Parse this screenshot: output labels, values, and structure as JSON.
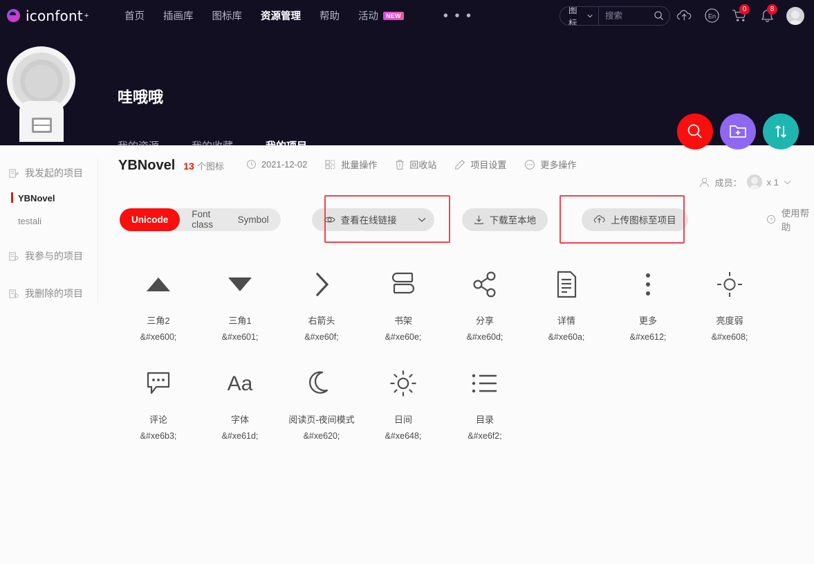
{
  "topnav": {
    "logo": "iconfont",
    "logo_plus": "+",
    "items": [
      {
        "label": "首页",
        "active": false,
        "badge": ""
      },
      {
        "label": "插画库",
        "active": false,
        "badge": ""
      },
      {
        "label": "图标库",
        "active": false,
        "badge": ""
      },
      {
        "label": "资源管理",
        "active": true,
        "badge": ""
      },
      {
        "label": "帮助",
        "active": false,
        "badge": ""
      },
      {
        "label": "活动",
        "active": false,
        "badge": "NEW"
      }
    ],
    "more_dots": "• • •",
    "search": {
      "type_label": "图标",
      "placeholder": "搜索",
      "value": ""
    },
    "cart_count": "0",
    "notify_count": "8"
  },
  "profile": {
    "name": "哇哦哦",
    "tabs": [
      {
        "label": "我的资源",
        "active": false
      },
      {
        "label": "我的收藏",
        "active": false
      },
      {
        "label": "我的项目",
        "active": true
      }
    ]
  },
  "sidebar": {
    "groups": [
      {
        "label": "我发起的项目",
        "icon": "project-created-icon",
        "children": [
          {
            "label": "YBNovel",
            "active": true
          },
          {
            "label": "testali",
            "active": false
          }
        ]
      },
      {
        "label": "我参与的项目",
        "icon": "project-joined-icon",
        "children": []
      },
      {
        "label": "我删除的项目",
        "icon": "project-deleted-icon",
        "children": []
      }
    ]
  },
  "project": {
    "title": "YBNovel",
    "icon_count": "13",
    "icon_count_unit": "个图标",
    "date": "2021-12-02",
    "actions": [
      {
        "label": "批量操作",
        "icon": "batch-icon"
      },
      {
        "label": "回收站",
        "icon": "trash-icon"
      },
      {
        "label": "项目设置",
        "icon": "pencil-icon"
      },
      {
        "label": "更多操作",
        "icon": "ellipsis-circle-icon"
      }
    ],
    "members_label": "成员：",
    "members_count": "x 1"
  },
  "toolbar": {
    "segments": [
      {
        "label": "Unicode",
        "active": true
      },
      {
        "label": "Font class",
        "active": false
      },
      {
        "label": "Symbol",
        "active": false
      }
    ],
    "view_link_label": "查看在线链接",
    "download_label": "下载至本地",
    "upload_label": "上传图标至项目",
    "help_label": "使用帮助",
    "highlight_color": "#f3434a"
  },
  "icons": [
    {
      "name": "三角2",
      "code": "&#xe600;",
      "glyph": "triangle-up-icon"
    },
    {
      "name": "三角1",
      "code": "&#xe601;",
      "glyph": "triangle-down-icon"
    },
    {
      "name": "右箭头",
      "code": "&#xe60f;",
      "glyph": "chevron-right-icon"
    },
    {
      "name": "书架",
      "code": "&#xe60e;",
      "glyph": "bookshelf-icon"
    },
    {
      "name": "分享",
      "code": "&#xe60d;",
      "glyph": "share-icon"
    },
    {
      "name": "详情",
      "code": "&#xe60a;",
      "glyph": "document-detail-icon"
    },
    {
      "name": "更多",
      "code": "&#xe612;",
      "glyph": "more-vertical-icon"
    },
    {
      "name": "亮度弱",
      "code": "&#xe608;",
      "glyph": "brightness-low-icon"
    },
    {
      "name": "评论",
      "code": "&#xe6b3;",
      "glyph": "comment-icon"
    },
    {
      "name": "字体",
      "code": "&#xe61d;",
      "glyph": "font-aa-icon"
    },
    {
      "name": "阅读页-夜间模式",
      "code": "&#xe620;",
      "glyph": "moon-icon"
    },
    {
      "name": "日间",
      "code": "&#xe648;",
      "glyph": "sun-icon"
    },
    {
      "name": "目录",
      "code": "&#xe6f2;",
      "glyph": "list-icon"
    }
  ]
}
